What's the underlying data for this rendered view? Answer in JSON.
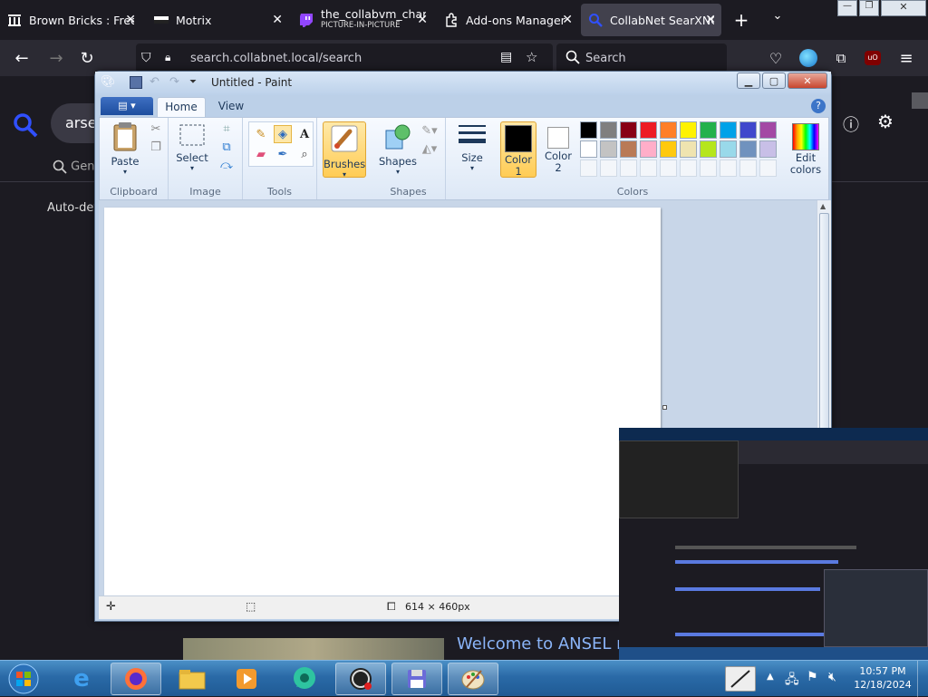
{
  "browser": {
    "tabs": [
      {
        "title": "Brown Bricks : Free",
        "icon": "museum-icon"
      },
      {
        "title": "Motrix",
        "icon": "motrix-icon"
      },
      {
        "title": "the_collabvm_char",
        "subtitle": "PICTURE-IN-PICTURE",
        "icon": "twitch-icon"
      },
      {
        "title": "Add-ons Manager",
        "icon": "puzzle-icon"
      },
      {
        "title": "CollabNet SearXNG",
        "icon": "search-icon",
        "active": true
      }
    ],
    "url": "search.collabnet.local/search",
    "search_placeholder": "Search",
    "page": {
      "query_text": "arsel",
      "general_tab": "Gen",
      "auto_detect": "Auto-det",
      "welcome": "Welcome to ANSEL r"
    }
  },
  "paint": {
    "title": "Untitled - Paint",
    "tabs": [
      "Home",
      "View"
    ],
    "groups": {
      "clipboard": "Clipboard",
      "image": "Image",
      "tools": "Tools",
      "shapes": "Shapes",
      "colors": "Colors"
    },
    "buttons": {
      "paste": "Paste",
      "select": "Select",
      "brushes": "Brushes",
      "shapes": "Shapes",
      "size": "Size",
      "color1": "Color\n1",
      "color2": "Color\n2",
      "edit_colors": "Edit\ncolors"
    },
    "color1": "#000000",
    "color2": "#ffffff",
    "palette_row1": [
      "#000000",
      "#7f7f7f",
      "#880015",
      "#ed1c24",
      "#ff7f27",
      "#fff200",
      "#22b14c",
      "#00a2e8",
      "#3f48cc",
      "#a349a4"
    ],
    "palette_row2": [
      "#ffffff",
      "#c3c3c3",
      "#b97a57",
      "#ffaec9",
      "#ffc90e",
      "#efe4b0",
      "#b5e61d",
      "#99d9ea",
      "#7092be",
      "#c8bfe7"
    ],
    "status": {
      "canvas_size": "614 × 460px"
    }
  },
  "taskbar": {
    "time": "10:57 PM",
    "date": "12/18/2024"
  }
}
